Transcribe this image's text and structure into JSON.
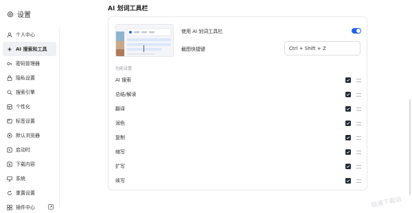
{
  "app": {
    "title": "设置"
  },
  "sidebar": {
    "items": [
      {
        "label": "个人中心",
        "icon": "user-icon"
      },
      {
        "label": "AI 搜索和工具",
        "icon": "sparkle-icon",
        "active": true
      },
      {
        "label": "密码管理器",
        "icon": "key-icon"
      },
      {
        "label": "隐私设置",
        "icon": "lock-icon"
      },
      {
        "label": "搜索引擎",
        "icon": "search-icon"
      },
      {
        "label": "个性化",
        "icon": "palette-icon"
      },
      {
        "label": "标签设置",
        "icon": "tab-icon"
      },
      {
        "label": "默认浏览器",
        "icon": "globe-icon"
      },
      {
        "label": "启动时",
        "icon": "power-icon"
      },
      {
        "label": "下载内容",
        "icon": "download-icon"
      },
      {
        "label": "系统",
        "icon": "monitor-icon"
      },
      {
        "label": "重置设置",
        "icon": "reset-icon"
      },
      {
        "label": "插件中心",
        "icon": "grid-icon"
      }
    ]
  },
  "main": {
    "title": "AI 划词工具栏",
    "enable_label": "使用 AI 划词工具栏",
    "enable_on": true,
    "shortcut_label": "截图快捷键",
    "shortcut_value": "Ctrl + Shift + Z",
    "section_label": "功能设置",
    "features": [
      {
        "label": "AI 搜索",
        "checked": true
      },
      {
        "label": "总结/解读",
        "checked": true
      },
      {
        "label": "翻译",
        "checked": true
      },
      {
        "label": "润色",
        "checked": true
      },
      {
        "label": "复制",
        "checked": true
      },
      {
        "label": "缩写",
        "checked": true
      },
      {
        "label": "扩写",
        "checked": true
      },
      {
        "label": "续写",
        "checked": true
      }
    ]
  },
  "watermark": "极速下载站",
  "colors": {
    "accent": "#2563eb",
    "checkbox": "#1f2937",
    "active_bg": "#eef0f4"
  }
}
